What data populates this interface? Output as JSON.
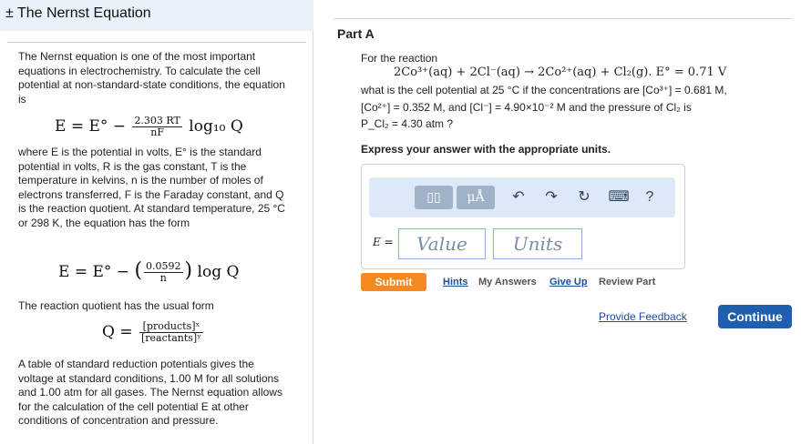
{
  "header": {
    "title": "± The Nernst Equation"
  },
  "intro": {
    "p1": "The Nernst equation is one of the most important equations in electrochemistry. To calculate the cell potential at non-standard-state conditions, the equation is",
    "eq1": {
      "lhs": "E = E° −",
      "frac_num": "2.303 RT",
      "frac_den": "nF",
      "rhs": "log₁₀ Q"
    },
    "p2": "where E is the potential in volts, E° is the standard potential in volts, R is the gas constant, T is the temperature in kelvins, n is the number of moles of electrons transferred, F is the Faraday constant, and Q is the reaction quotient. At standard temperature, 25 °C or 298 K, the equation has the form",
    "eq2": {
      "lhs": "E = E° −",
      "frac_num": "0.0592",
      "frac_den": "n",
      "rhs": "log Q"
    },
    "p3": "The reaction quotient has the usual form",
    "eq3": {
      "lhs": "Q =",
      "frac_num": "[products]ˣ",
      "frac_den": "[reactants]ʸ"
    },
    "p4": "A table of standard reduction potentials gives the voltage at standard conditions, 1.00 M for all solutions and 1.00 atm for all gases. The Nernst equation allows for the calculation of the cell potential E at other conditions of concentration and pressure."
  },
  "part": {
    "title": "Part A",
    "q_intro": "For the reaction",
    "reaction": "2Co³⁺(aq) + 2Cl⁻(aq) → 2Co²⁺(aq) + Cl₂(g).  E° = 0.71 V",
    "q_line1": "what is the cell potential at 25 °C if the concentrations are [Co³⁺] = 0.681 M,",
    "q_line2": "[Co²⁺] = 0.352 M, and [Cl⁻] = 4.90×10⁻² M and the pressure of Cl₂ is",
    "q_line3": "P_Cl₂ = 4.30 atm ?",
    "express": "Express your answer with the appropriate units."
  },
  "answer": {
    "toolbar": {
      "template_label": "▯▯",
      "units_label": "μÅ",
      "help_label": "?"
    },
    "e_label": "E =",
    "value_placeholder": "Value",
    "units_placeholder": "Units"
  },
  "actions": {
    "submit": "Submit",
    "hints": "Hints",
    "my_answers": "My Answers",
    "give_up": "Give Up",
    "review_part": "Review Part",
    "feedback": "Provide Feedback",
    "continue": "Continue"
  },
  "colors": {
    "header_bg": "#eaf1fa",
    "submit": "#f5891f",
    "continue": "#1f5fae",
    "link": "#1a4fa0"
  }
}
